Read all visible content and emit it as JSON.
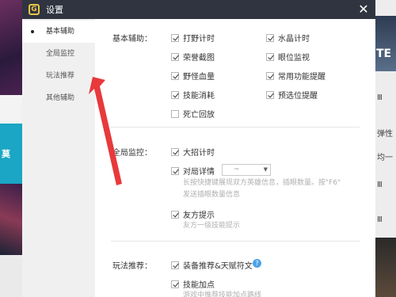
{
  "background": {
    "left_glyph": "莫",
    "right_glyph": "TE",
    "right_texts": [
      "Ⅲ",
      "弹性",
      "均一",
      "Ⅲ",
      "Ⅲ"
    ]
  },
  "dialog": {
    "logo_letter": "G",
    "title": "设置",
    "close_glyph": "✕"
  },
  "sidebar": {
    "items": [
      {
        "label": "基本辅助",
        "active": true
      },
      {
        "label": "全局监控",
        "active": false
      },
      {
        "label": "玩法推荐",
        "active": false
      },
      {
        "label": "其他辅助",
        "active": false
      }
    ]
  },
  "basic": {
    "title": "基本辅助：",
    "options": [
      {
        "label": "打野计时",
        "checked": true
      },
      {
        "label": "水晶计时",
        "checked": true
      },
      {
        "label": "荣誉截图",
        "checked": true
      },
      {
        "label": "眼位监视",
        "checked": true
      },
      {
        "label": "野怪血量",
        "checked": true
      },
      {
        "label": "常用功能提醒",
        "checked": true
      },
      {
        "label": "技能消耗",
        "checked": true
      },
      {
        "label": "预选位提醒",
        "checked": true
      },
      {
        "label": "死亡回放",
        "checked": false
      }
    ]
  },
  "monitor": {
    "title": "全局监控：",
    "ult_label": "大招计时",
    "detail_label": "对局详情",
    "select_value": "~",
    "detail_desc_1": "长按快捷键展现双方英雄信息，插眼数量。按\"F6\"",
    "detail_desc_2": "发送插眼数量信息",
    "ally_label": "友方提示",
    "ally_desc": "友方一级技能提示"
  },
  "play": {
    "title": "玩法推荐：",
    "rec_label": "装备推荐&天赋符文",
    "help_glyph": "?",
    "skill_label": "技能加点",
    "skill_desc": "游戏中推荐技能加点路线"
  },
  "colors": {
    "titlebar": "#2f3440",
    "logo": "#e8c547",
    "arrow": "#e8393b",
    "help": "#4ba3e8"
  }
}
